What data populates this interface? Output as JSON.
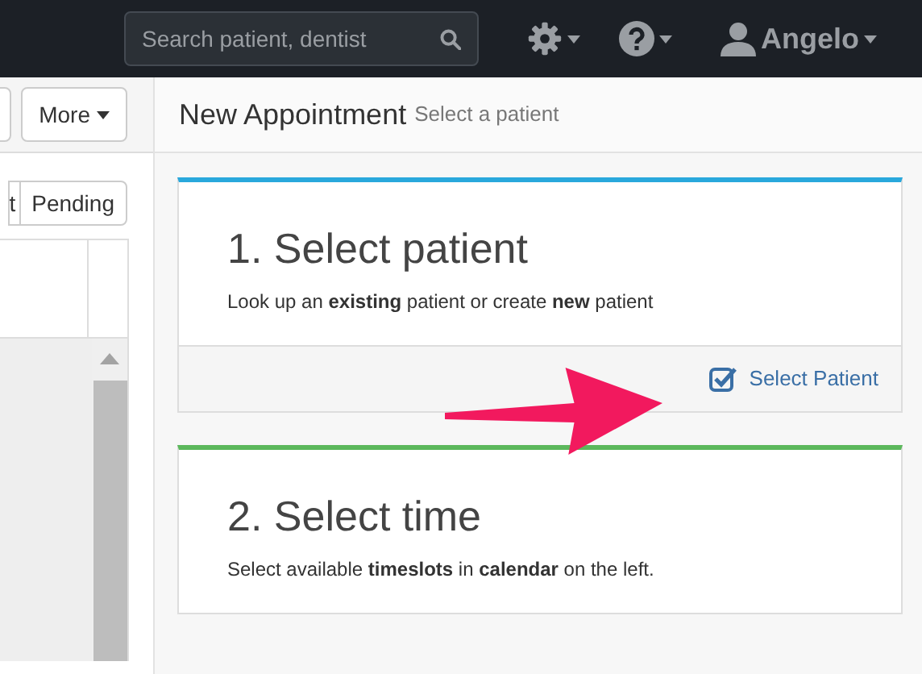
{
  "navbar": {
    "search": {
      "placeholder": "Search patient, dentist"
    },
    "user": "Angelo"
  },
  "toolbar": {
    "buttons": [
      "More"
    ]
  },
  "filters": [
    {
      "label": "t",
      "selected": false
    },
    {
      "label": "Pending",
      "selected": false
    }
  ],
  "header": {
    "title": "New Appointment",
    "subtitle": "Select a patient"
  },
  "steps": [
    {
      "title": "1. Select patient",
      "text": "Look up an **existing** patient or create **new** patient",
      "color": "#29a8dc",
      "action": "Select Patient"
    },
    {
      "title": "2. Select time",
      "text": "Select available **timeslots** in **calendar** on the left.",
      "color": "#5cb85c"
    }
  ]
}
